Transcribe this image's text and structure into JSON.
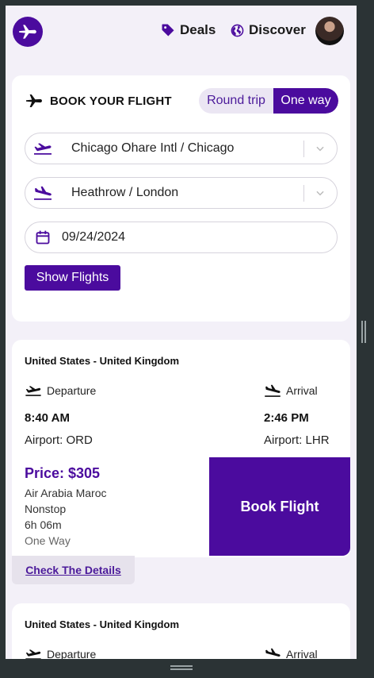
{
  "header": {
    "deals_label": "Deals",
    "discover_label": "Discover"
  },
  "search": {
    "title": "BOOK YOUR FLIGHT",
    "trip_options": [
      "Round trip",
      "One way"
    ],
    "selected_trip": "One way",
    "from_value": "Chicago Ohare Intl / Chicago",
    "to_value": "Heathrow / London",
    "date_value": "09/24/2024",
    "show_button": "Show Flights"
  },
  "results": [
    {
      "route": "United States - United Kingdom",
      "departure_label": "Departure",
      "arrival_label": "Arrival",
      "departure_time": "8:40 AM",
      "arrival_time": "2:46 PM",
      "departure_airport": "Airport: ORD",
      "arrival_airport": "Airport: LHR",
      "price": "Price: $305",
      "airline": "Air Arabia Maroc",
      "stops": "Nonstop",
      "duration": "6h 06m",
      "trip_type": "One Way",
      "book_label": "Book Flight",
      "details_label": "Check The Details"
    },
    {
      "route": "United States - United Kingdom",
      "departure_label": "Departure",
      "arrival_label": "Arrival"
    }
  ],
  "colors": {
    "brand": "#4b0b9e",
    "page_bg": "#f3f0f8",
    "card_bg": "#ffffff"
  },
  "icons": [
    "plane-logo-icon",
    "tag-icon",
    "globe-icon",
    "plane-icon",
    "takeoff-icon",
    "landing-icon",
    "calendar-icon",
    "chevron-down-icon"
  ]
}
